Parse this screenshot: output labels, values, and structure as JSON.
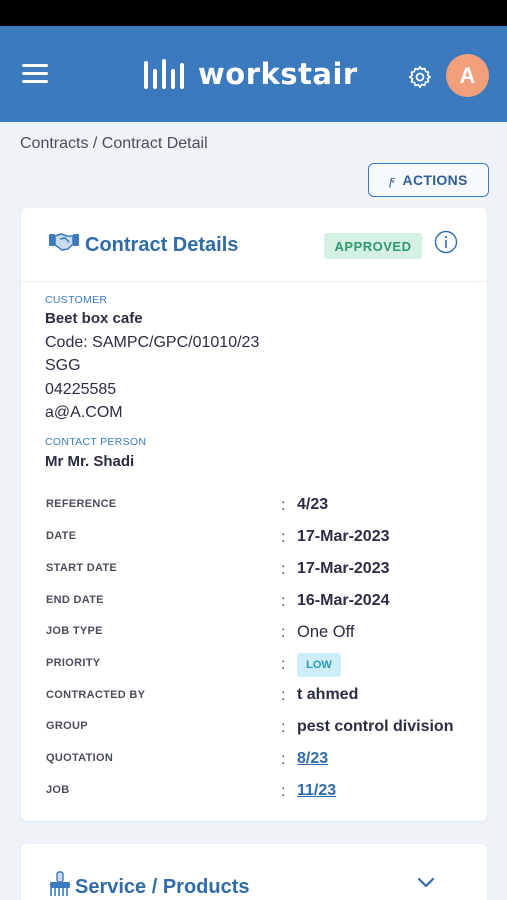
{
  "app": {
    "brand": "workstair"
  },
  "header": {
    "avatar_initial": "A"
  },
  "breadcrumb": "Contracts / Contract Detail",
  "actions": {
    "label": "ACTIONS",
    "icon": "bolt-icon"
  },
  "card": {
    "title": "Contract Details",
    "status": "APPROVED",
    "customer_label": "CUSTOMER",
    "customer_name": "Beet box  cafe",
    "customer_code": "Code: SAMPC/GPC/01010/23",
    "customer_area": "SGG",
    "customer_phone": "04225585",
    "customer_email": "a@A.COM",
    "contact_label": "CONTACT PERSON",
    "contact_name": "Mr Mr. Shadi"
  },
  "fields": {
    "reference": {
      "label": "REFERENCE",
      "value": "4/23"
    },
    "date": {
      "label": "DATE",
      "value": "17-Mar-2023"
    },
    "start_date": {
      "label": "START DATE",
      "value": "17-Mar-2023"
    },
    "end_date": {
      "label": "END DATE",
      "value": "16-Mar-2024"
    },
    "job_type": {
      "label": "JOB TYPE",
      "value": "One Off"
    },
    "priority": {
      "label": "PRIORITY",
      "value": "LOW"
    },
    "contracted_by": {
      "label": "CONTRACTED BY",
      "value": "t ahmed"
    },
    "group": {
      "label": "GROUP",
      "value": "pest control division"
    },
    "quotation": {
      "label": "QUOTATION",
      "value": "8/23"
    },
    "job": {
      "label": "JOB",
      "value": "11/23"
    }
  },
  "colon": ":",
  "services": {
    "title": "Service / Products"
  },
  "colors": {
    "header_bg": "#3b7bbd",
    "accent": "#2f6ca8",
    "approved_bg": "#d4f1e4",
    "approved_text": "#2f9a6a",
    "low_bg": "#cdeef6",
    "low_text": "#2a9bbf",
    "avatar": "#f2a07b"
  }
}
